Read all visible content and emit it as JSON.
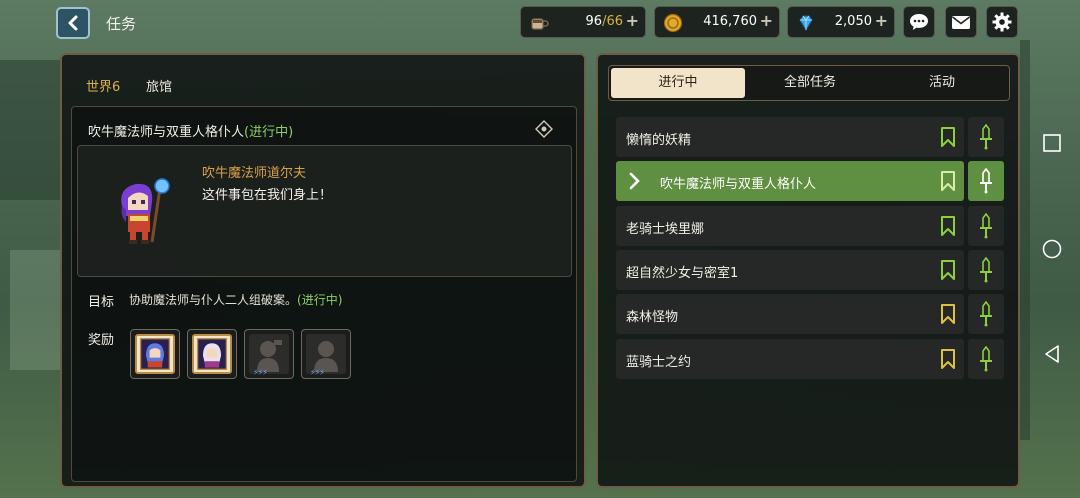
{
  "header": {
    "title": "任务",
    "stamina": {
      "current": "96",
      "max": "66",
      "separator": "/",
      "plus": "+"
    },
    "gold": {
      "value": "416,760",
      "plus": "+"
    },
    "gems": {
      "value": "2,050",
      "plus": "+"
    }
  },
  "location": {
    "world": "世界6",
    "place": "旅馆"
  },
  "quest_detail": {
    "title": "吹牛魔法师与双重人格仆人",
    "status": "(进行中)",
    "npc_name": "吹牛魔法师道尔夫",
    "npc_line": "这件事包在我们身上！",
    "objective_label": "目标",
    "objective_text": "协助魔法师与仆人二人组破案。",
    "objective_status": "(进行中)",
    "reward_label": "奖励",
    "rewards": [
      {
        "icon": "hero-card-icon",
        "owned": true
      },
      {
        "icon": "hero-card-icon",
        "owned": true
      },
      {
        "icon": "locked-hero-silhouette-icon",
        "owned": false,
        "stars": "⚡⚡⚡"
      },
      {
        "icon": "locked-hero-silhouette-icon",
        "owned": false,
        "stars": "⚡⚡⚡"
      }
    ]
  },
  "tabs": [
    {
      "label": "进行中",
      "active": true
    },
    {
      "label": "全部任务",
      "active": false
    },
    {
      "label": "活动",
      "active": false
    }
  ],
  "quests": [
    {
      "name": "懒惰的妖精",
      "active": false,
      "bookmark_color": "#8ccf3f"
    },
    {
      "name": "吹牛魔法师与双重人格仆人",
      "active": true,
      "bookmark_color": "#8ccf3f"
    },
    {
      "name": "老骑士埃里娜",
      "active": false,
      "bookmark_color": "#8ccf3f"
    },
    {
      "name": "超自然少女与密室1",
      "active": false,
      "bookmark_color": "#8ccf3f"
    },
    {
      "name": "森林怪物",
      "active": false,
      "bookmark_color": "#e0c040"
    },
    {
      "name": "蓝骑士之约",
      "active": false,
      "bookmark_color": "#e0c040"
    }
  ],
  "colors": {
    "accent_green": "#5f9041",
    "progress_green": "#8ccf63",
    "gold_text": "#d8b24a",
    "panel_border": "#6c5d44"
  }
}
